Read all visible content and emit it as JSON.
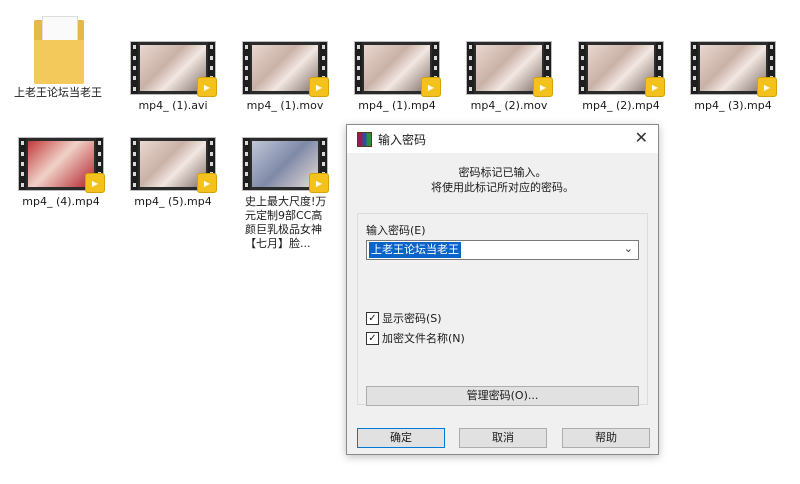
{
  "files": [
    {
      "name": "上老王论坛当老王",
      "type": "folder"
    },
    {
      "name": "mp4_ (1).avi"
    },
    {
      "name": "mp4_ (1).mov"
    },
    {
      "name": "mp4_ (1).mp4"
    },
    {
      "name": "mp4_ (2).mov"
    },
    {
      "name": "mp4_ (2).mp4"
    },
    {
      "name": "mp4_ (3).mp4"
    },
    {
      "name": "mp4_ (4).mp4"
    },
    {
      "name": "mp4_ (5).mp4"
    },
    {
      "name": "史上最大尺度!万元定制9部CC高颜巨乳极品女神【七月】脸..."
    }
  ],
  "badge_text": "Player",
  "dialog": {
    "title": "输入密码",
    "message_line1": "密码标记已输入。",
    "message_line2": "将使用此标记所对应的密码。",
    "password_label": "输入密码(E)",
    "password_value": "上老王论坛当老王",
    "show_password": "显示密码(S)",
    "encrypt_names": "加密文件名称(N)",
    "manage_button": "管理密码(O)...",
    "ok_button": "确定",
    "cancel_button": "取消",
    "help_button": "帮助"
  },
  "colors": {
    "badge": "#f4c21c",
    "folder": "#f3c95c",
    "selection": "#0a64c8",
    "default_button_border": "#0078d7"
  }
}
